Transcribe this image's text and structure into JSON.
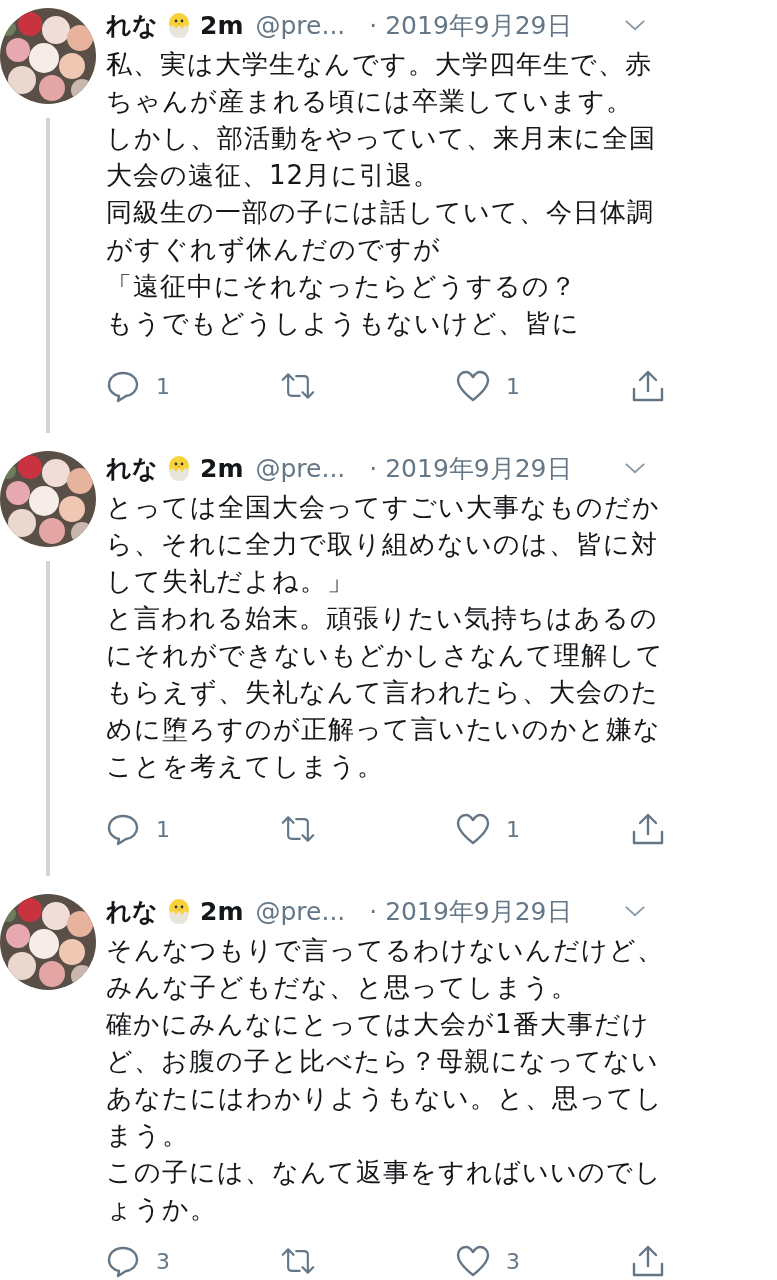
{
  "tweets": [
    {
      "name": "れな",
      "badge": "2m",
      "handle": "@pre...",
      "date": "· 2019年9月29日",
      "thread_continues": true,
      "lines": [
        "私、実は大学生なんです。大学四年生で、赤",
        "ちゃんが産まれる頃には卒業しています。",
        "しかし、部活動をやっていて、来月末に全国",
        "大会の遠征、12月に引退。",
        "同級生の一部の子には話していて、今日体調",
        "がすぐれず休んだのですが",
        "「遠征中にそれなったらどうするの？",
        "もうでもどうしようもないけど、皆に"
      ],
      "replies": "1",
      "likes": "1"
    },
    {
      "name": "れな",
      "badge": "2m",
      "handle": "@pre...",
      "date": "· 2019年9月29日",
      "thread_continues": true,
      "lines": [
        "とっては全国大会ってすごい大事なものだか",
        "ら、それに全力で取り組めないのは、皆に対",
        "して失礼だよね。」",
        "と言われる始末。頑張りたい気持ちはあるの",
        "にそれができないもどかしさなんて理解して",
        "もらえず、失礼なんて言われたら、大会のた",
        "めに堕ろすのが正解って言いたいのかと嫌な",
        "ことを考えてしまう。"
      ],
      "replies": "1",
      "likes": "1"
    },
    {
      "name": "れな",
      "badge": "2m",
      "handle": "@pre...",
      "date": "· 2019年9月29日",
      "thread_continues": false,
      "lines": [
        "そんなつもりで言ってるわけないんだけど、",
        "みんな子どもだな、と思ってしまう。",
        "確かにみんなにとっては大会が1番大事だけ",
        "ど、お腹の子と比べたら？母親になってない",
        "あなたにはわかりようもない。と、思ってし",
        "まう。",
        "この子には、なんて返事をすればいいのでし",
        "ょうか。"
      ],
      "replies": "3",
      "likes": "3"
    }
  ]
}
